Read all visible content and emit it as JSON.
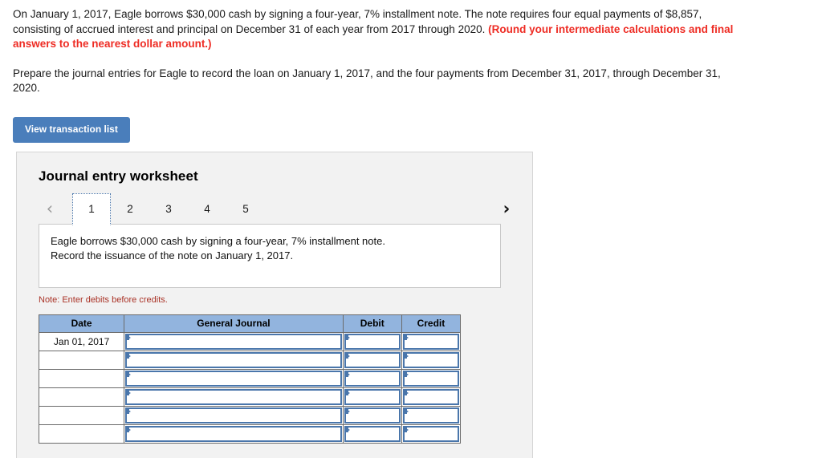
{
  "problem": {
    "paragraph1_part1": "On January 1, 2017, Eagle borrows $30,000 cash by signing a four-year, 7% installment note. The note requires four equal payments of $8,857, consisting of accrued interest and principal on December 31 of each year from 2017 through 2020. ",
    "paragraph1_emphasis": "(Round your intermediate calculations and final answers to the nearest dollar amount.)",
    "paragraph2": "Prepare the journal entries for Eagle to record the loan on January 1, 2017, and the four payments from December 31, 2017, through December 31, 2020."
  },
  "toolbar": {
    "view_transaction_list_label": "View transaction list"
  },
  "worksheet": {
    "title": "Journal entry worksheet",
    "nav": {
      "prev_icon": "chevron-left-icon",
      "next_icon": "chevron-right-icon",
      "prev_glyph": "‹",
      "next_glyph": "›"
    },
    "tabs": [
      {
        "label": "1",
        "active": true
      },
      {
        "label": "2",
        "active": false
      },
      {
        "label": "3",
        "active": false
      },
      {
        "label": "4",
        "active": false
      },
      {
        "label": "5",
        "active": false
      }
    ],
    "description": {
      "line1": "Eagle borrows $30,000 cash by signing a four-year, 7% installment note.",
      "line2": "Record the issuance of the note on January 1, 2017."
    },
    "note": "Note: Enter debits before credits.",
    "table": {
      "headers": [
        "Date",
        "General Journal",
        "Debit",
        "Credit"
      ],
      "rows": [
        {
          "date": "Jan 01, 2017",
          "general_journal": "",
          "debit": "",
          "credit": ""
        },
        {
          "date": "",
          "general_journal": "",
          "debit": "",
          "credit": ""
        },
        {
          "date": "",
          "general_journal": "",
          "debit": "",
          "credit": ""
        },
        {
          "date": "",
          "general_journal": "",
          "debit": "",
          "credit": ""
        },
        {
          "date": "",
          "general_journal": "",
          "debit": "",
          "credit": ""
        },
        {
          "date": "",
          "general_journal": "",
          "debit": "",
          "credit": ""
        }
      ]
    }
  },
  "colors": {
    "button_blue": "#4a7ebb",
    "table_header_blue": "#92b4de",
    "input_border_blue": "#4a76ab",
    "emphasis_red": "#ee2c24",
    "note_red": "#a93226",
    "panel_bg": "#f2f2f2"
  }
}
